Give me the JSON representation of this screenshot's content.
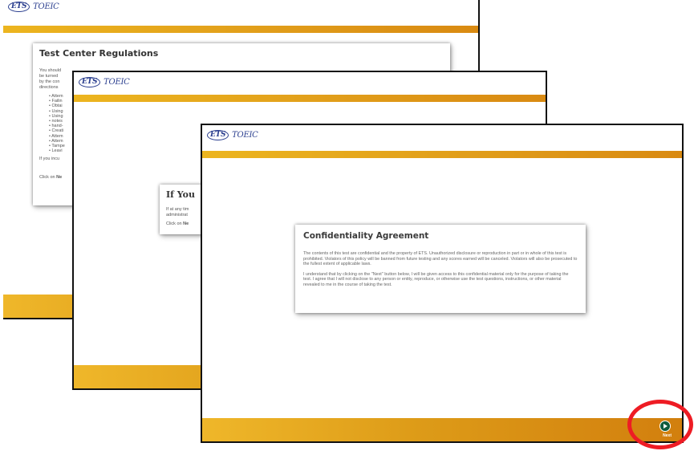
{
  "brand": {
    "ets": "ETS",
    "toeic": "TOEIC"
  },
  "colors": {
    "bar_start": "#ecb51f",
    "bar_end": "#d27f0e",
    "highlight": "#ee1c24",
    "next_button": "#0f5c3d"
  },
  "screen1": {
    "panel_title": "Test Center Regulations",
    "para": [
      "You should",
      "be turned",
      "by the con",
      "directions"
    ],
    "bullets": [
      "Attem",
      "Failin",
      "Obtai",
      "Using",
      "Using",
      "notes",
      "hand-",
      "Creati",
      "Attem",
      "Attem",
      "Tampe",
      "Leavi"
    ],
    "foot": "If you incu",
    "click_prefix": "Click on ",
    "click_bold": "Ne"
  },
  "screen2": {
    "panel_title": "If You",
    "para": [
      "If at any tim",
      "administrat"
    ],
    "click_prefix": "Click on ",
    "click_bold": "Ne"
  },
  "screen3": {
    "panel_title": "Confidentiality Agreement",
    "para1": "The contents of this test are confidential and the property of ETS. Unauthorized disclosure or reproduction in part or in whole of this test is prohibited. Violators of this policy will be banned from future testing and any scores earned will be canceled. Violators will also be prosecuted to the fullest extent of applicable laws.",
    "para2": "I understand that by clicking on the \"Next\" button below, I will be given access to this confidential material only for the purpose of taking the test. I agree that I will not disclose to any person or entity, reproduce, or otherwise use the test questions, instructions, or other material revealed to me in the course of taking the test.",
    "next_label": "Next"
  }
}
